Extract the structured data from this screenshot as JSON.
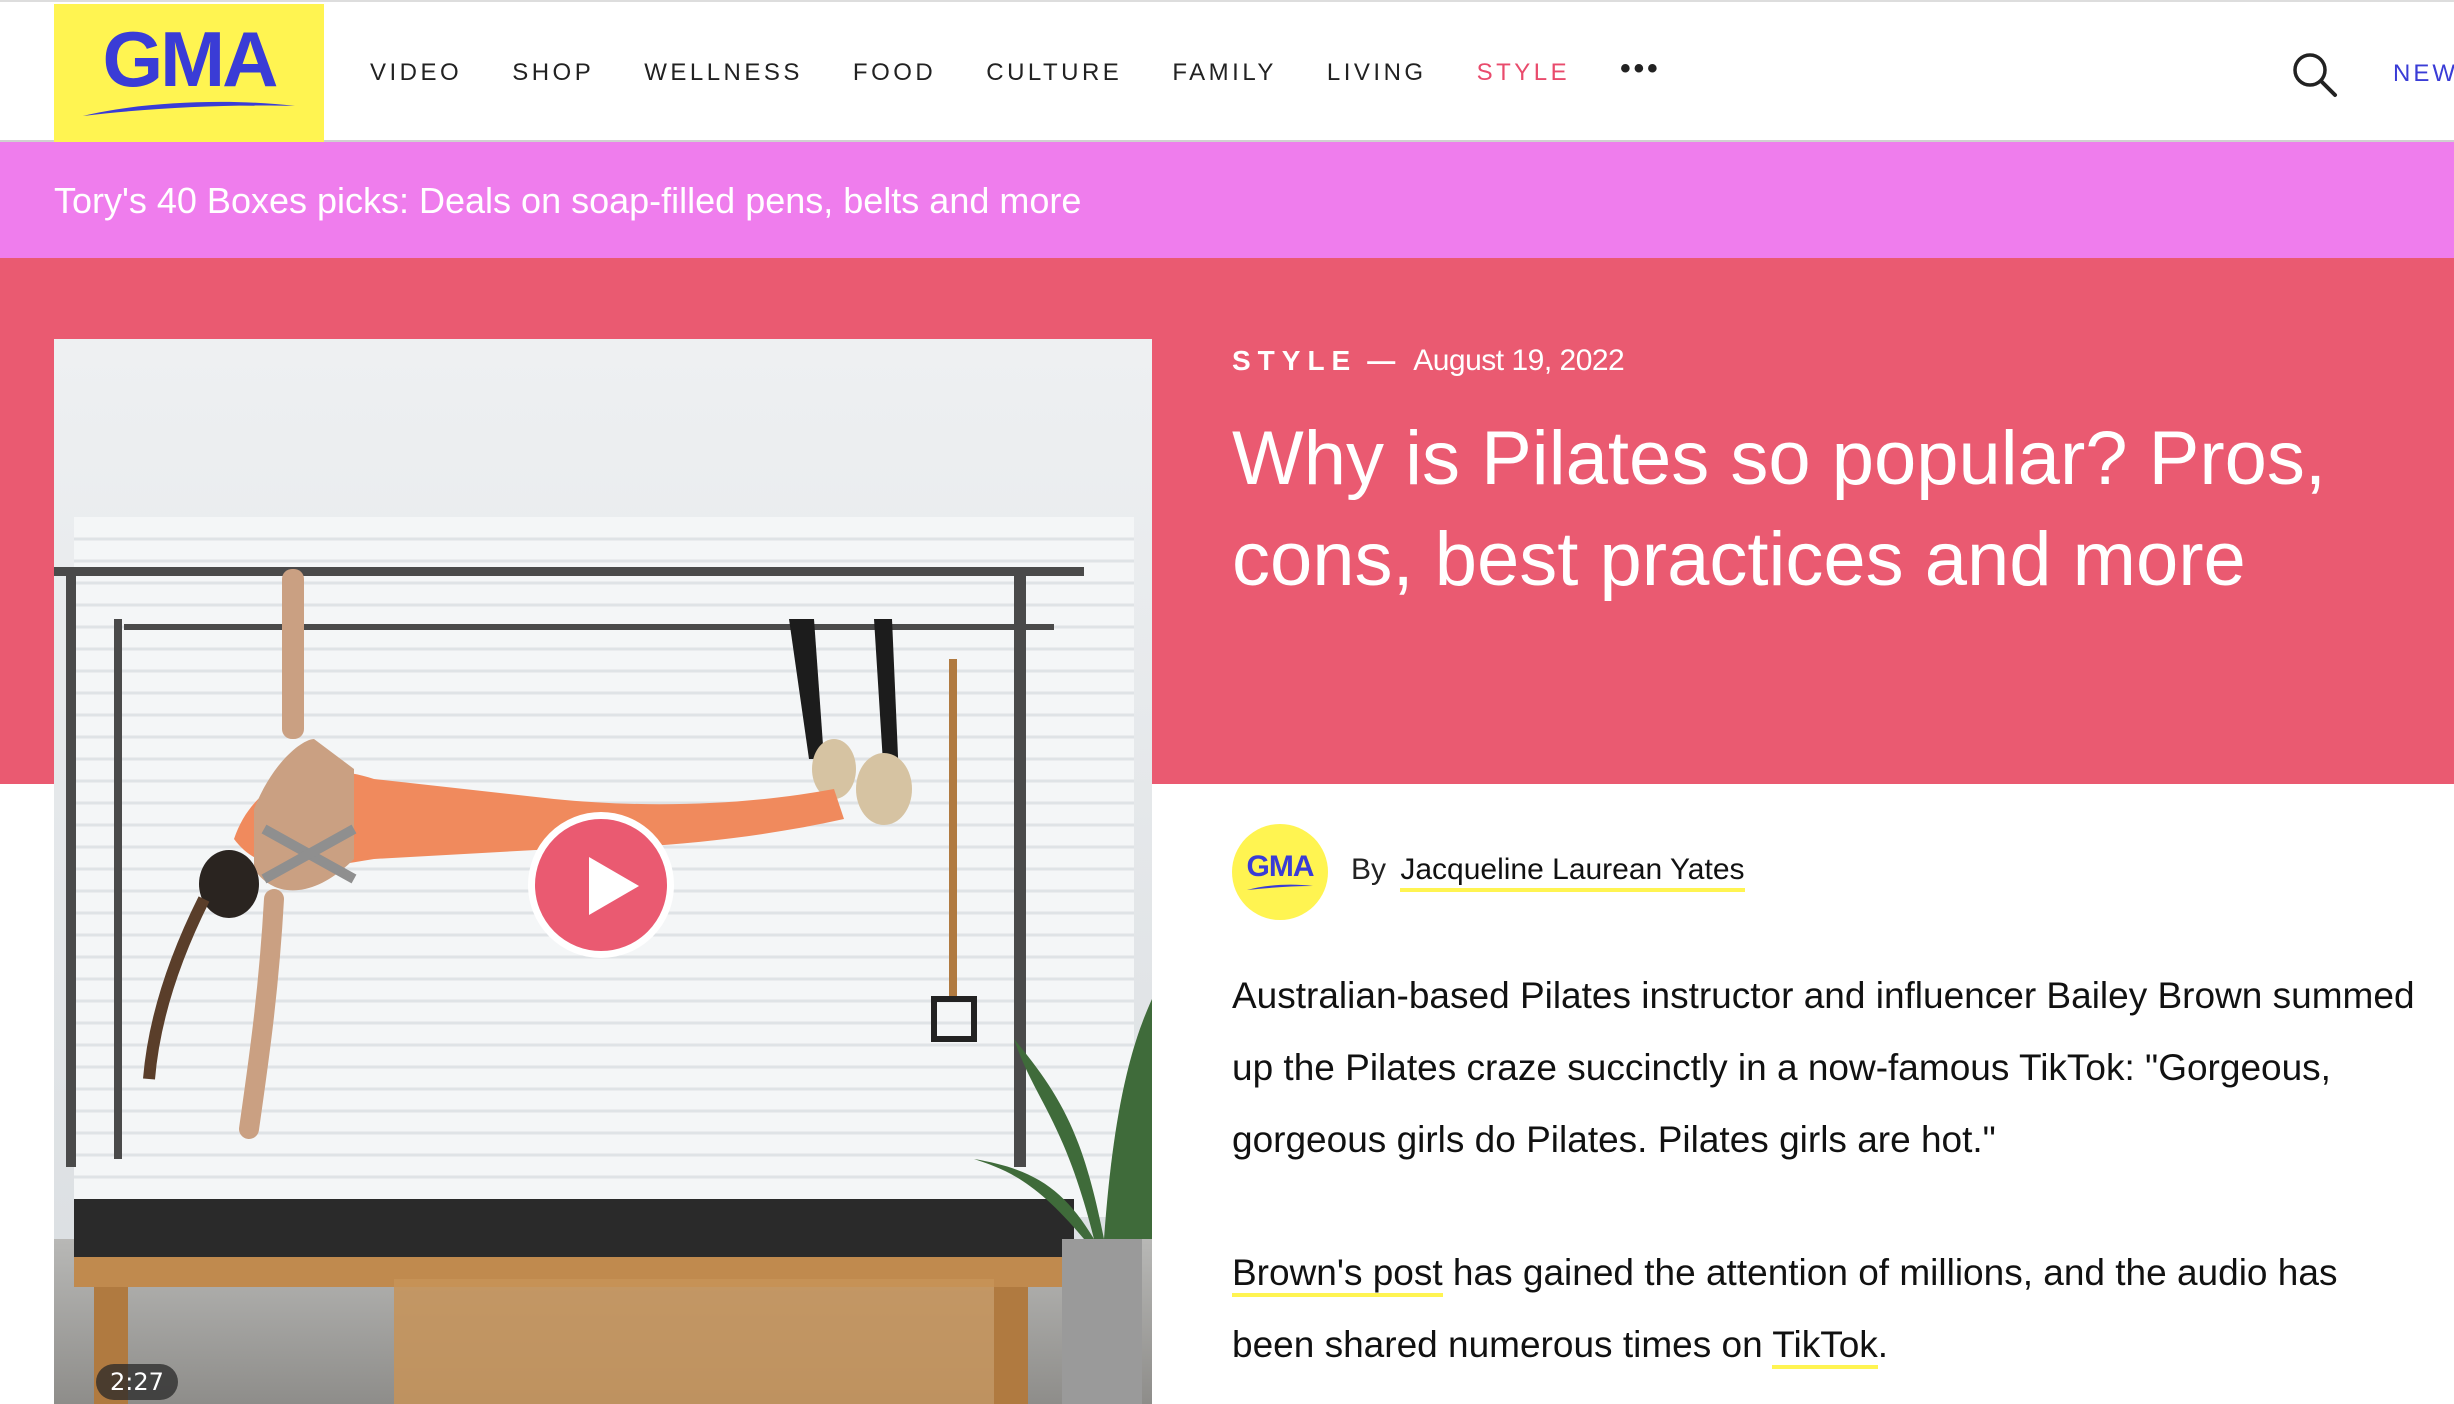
{
  "colors": {
    "brand_yellow": "#fff451",
    "brand_blue": "#3a3cd6",
    "hero_pink": "#ea5a71",
    "promo_magenta": "#ef7ded",
    "active_nav": "#e94b6c"
  },
  "header": {
    "logo_text": "GMA",
    "nav": [
      "VIDEO",
      "SHOP",
      "WELLNESS",
      "FOOD",
      "CULTURE",
      "FAMILY",
      "LIVING",
      "STYLE"
    ],
    "active_nav": "STYLE",
    "more_label": "•••",
    "search_icon": "search-icon",
    "right_link": "NEW"
  },
  "promo": {
    "text": "Tory's 40 Boxes picks: Deals on soap-filled pens, belts and more"
  },
  "article": {
    "category": "STYLE",
    "dash": "—",
    "date": "August 19, 2022",
    "headline": "Why is Pilates so popular? Pros, cons, best practices and more",
    "video": {
      "duration": "2:27",
      "play_icon": "play-icon"
    },
    "byline": {
      "avatar_text": "GMA",
      "prefix": "By",
      "author": "Jacqueline Laurean Yates"
    },
    "paragraph1": "Australian-based Pilates instructor and influencer Bailey Brown summed up the Pilates craze succinctly in a now-famous TikTok: \"Gorgeous, gorgeous girls do Pilates. Pilates girls are hot.\"",
    "paragraph2": {
      "link1": "Brown's post",
      "middle": " has gained the attention of millions, and the audio has been shared numerous times on ",
      "link2": "TikTok",
      "end": "."
    }
  }
}
